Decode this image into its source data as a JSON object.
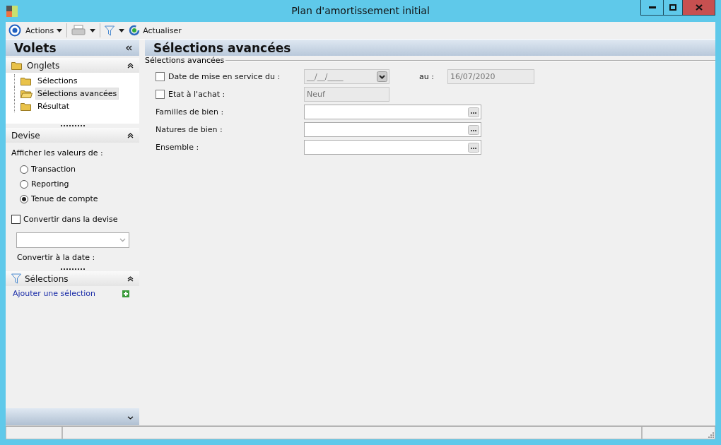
{
  "window": {
    "title": "Plan d'amortissement initial"
  },
  "toolbar": [
    {
      "kind": "actions",
      "label": "Actions"
    },
    {
      "kind": "print"
    },
    {
      "kind": "filter"
    },
    {
      "kind": "refresh",
      "label": "Actualiser"
    }
  ],
  "sidebar": {
    "title": "Volets",
    "tabs_section": {
      "title": "Onglets",
      "expanded": true,
      "items": [
        {
          "label": "Sélections",
          "selected": false
        },
        {
          "label": "Sélections avancées",
          "selected": true
        },
        {
          "label": "Résultat",
          "selected": false
        }
      ]
    },
    "currency_section": {
      "title": "Devise",
      "expanded": true,
      "prompt": "Afficher les valeurs de :",
      "options": [
        {
          "label": "Transaction",
          "selected": false
        },
        {
          "label": "Reporting",
          "selected": false
        },
        {
          "label": "Tenue de compte",
          "selected": true
        }
      ],
      "convert": {
        "label": "Convertir dans la devise",
        "checked": false
      },
      "date_label": "Convertir à la date :"
    },
    "selections_section": {
      "title": "Sélections",
      "expanded": true,
      "link": "Ajouter une sélection"
    }
  },
  "content": {
    "title": "Sélections avancées",
    "group": "Sélections avancées",
    "rows": [
      {
        "kind": "daterange",
        "checked": false,
        "label": "Date de mise en service du :",
        "from": "__/__/____",
        "to_label": "au :",
        "to": "16/07/2020"
      },
      {
        "kind": "state",
        "checked": false,
        "label": "Etat à l'achat :",
        "value": "Neuf"
      },
      {
        "kind": "lookup",
        "label": "Familles de bien :"
      },
      {
        "kind": "lookup",
        "label": "Natures de bien :"
      },
      {
        "kind": "lookup",
        "label": "Ensemble :"
      }
    ]
  }
}
